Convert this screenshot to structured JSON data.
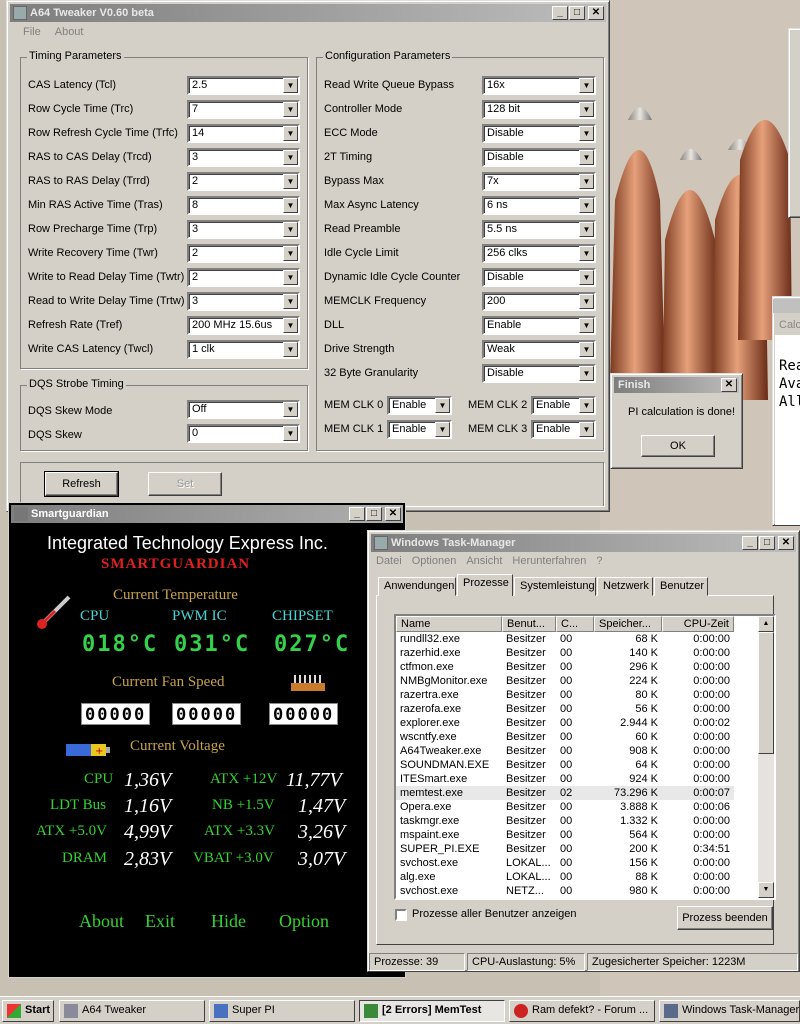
{
  "a64": {
    "title": "A64 Tweaker V0.60 beta",
    "menu": [
      "File",
      "About"
    ],
    "timing_title": "Timing Parameters",
    "timing": [
      {
        "label": "CAS Latency (Tcl)",
        "value": "2.5"
      },
      {
        "label": "Row Cycle Time (Trc)",
        "value": "7"
      },
      {
        "label": "Row Refresh Cycle Time (Trfc)",
        "value": "14"
      },
      {
        "label": "RAS to CAS Delay (Trcd)",
        "value": "3"
      },
      {
        "label": "RAS to RAS Delay (Trrd)",
        "value": "2"
      },
      {
        "label": "Min RAS Active Time (Tras)",
        "value": "8"
      },
      {
        "label": "Row Precharge Time (Trp)",
        "value": "3"
      },
      {
        "label": "Write Recovery Time (Twr)",
        "value": "2"
      },
      {
        "label": "Write to Read Delay Time (Twtr)",
        "value": "2"
      },
      {
        "label": "Read to Write Delay Time (Trtw)",
        "value": "3"
      },
      {
        "label": "Refresh Rate (Tref)",
        "value": "200 MHz 15.6us"
      },
      {
        "label": "Write CAS Latency (Twcl)",
        "value": "1 clk"
      }
    ],
    "dqs_title": "DQS Strobe Timing",
    "dqs": [
      {
        "label": "DQS Skew Mode",
        "value": "Off"
      },
      {
        "label": "DQS Skew",
        "value": "0"
      }
    ],
    "config_title": "Configuration Parameters",
    "config": [
      {
        "label": "Read Write Queue Bypass",
        "value": "16x"
      },
      {
        "label": "Controller Mode",
        "value": "128 bit"
      },
      {
        "label": "ECC Mode",
        "value": "Disable"
      },
      {
        "label": "2T Timing",
        "value": "Disable"
      },
      {
        "label": "Bypass Max",
        "value": "7x"
      },
      {
        "label": "Max Async Latency",
        "value": "6 ns"
      },
      {
        "label": "Read Preamble",
        "value": "5.5 ns"
      },
      {
        "label": "Idle Cycle Limit",
        "value": "256 clks"
      },
      {
        "label": "Dynamic Idle Cycle Counter",
        "value": "Disable"
      },
      {
        "label": "MEMCLK Frequency",
        "value": "200"
      },
      {
        "label": "DLL",
        "value": "Enable"
      },
      {
        "label": "Drive Strength",
        "value": "Weak"
      },
      {
        "label": "32 Byte Granularity",
        "value": "Disable"
      }
    ],
    "memclk": [
      {
        "label": "MEM CLK 0",
        "value": "Enable"
      },
      {
        "label": "MEM CLK 2",
        "value": "Enable"
      },
      {
        "label": "MEM CLK 1",
        "value": "Enable"
      },
      {
        "label": "MEM CLK 3",
        "value": "Enable"
      }
    ],
    "refresh": "Refresh",
    "set": "Set"
  },
  "finish": {
    "title": "Finish",
    "message": "PI calculation is done!",
    "ok": "OK"
  },
  "bg": {
    "calc": "Calc",
    "lines": [
      "Rea",
      "Ava",
      "All"
    ]
  },
  "sg": {
    "title": "Smartguardian",
    "company": "Integrated Technology Express Inc.",
    "product": "SMARTGUARDIAN",
    "temp_title": "Current Temperature",
    "temps": [
      {
        "name": "CPU",
        "value": "018°C"
      },
      {
        "name": "PWM IC",
        "value": "031°C"
      },
      {
        "name": "CHIPSET",
        "value": "027°C"
      }
    ],
    "fan_title": "Current Fan Speed",
    "fans": [
      "00000",
      "00000",
      "00000"
    ],
    "volt_title": "Current Voltage",
    "volts": [
      {
        "name": "CPU",
        "value": "1,36V"
      },
      {
        "name": "ATX +12V",
        "value": "11,77V"
      },
      {
        "name": "LDT Bus",
        "value": "1,16V"
      },
      {
        "name": "NB +1.5V",
        "value": "1,47V"
      },
      {
        "name": "ATX +5.0V",
        "value": "4,99V"
      },
      {
        "name": "ATX +3.3V",
        "value": "3,26V"
      },
      {
        "name": "DRAM",
        "value": "2,83V"
      },
      {
        "name": "VBAT +3.0V",
        "value": "3,07V"
      }
    ],
    "menu": [
      "About",
      "Exit",
      "Hide",
      "Option"
    ]
  },
  "tm": {
    "title": "Windows Task-Manager",
    "menu": [
      "Datei",
      "Optionen",
      "Ansicht",
      "Herunterfahren",
      "?"
    ],
    "tabs": [
      "Anwendungen",
      "Prozesse",
      "Systemleistung",
      "Netzwerk",
      "Benutzer"
    ],
    "columns": [
      "Name",
      "Benut...",
      "C...",
      "Speicher...",
      "CPU-Zeit"
    ],
    "rows": [
      [
        "rundll32.exe",
        "Besitzer",
        "00",
        "68 K",
        "0:00:00"
      ],
      [
        "razerhid.exe",
        "Besitzer",
        "00",
        "140 K",
        "0:00:00"
      ],
      [
        "ctfmon.exe",
        "Besitzer",
        "00",
        "296 K",
        "0:00:00"
      ],
      [
        "NMBgMonitor.exe",
        "Besitzer",
        "00",
        "224 K",
        "0:00:00"
      ],
      [
        "razertra.exe",
        "Besitzer",
        "00",
        "80 K",
        "0:00:00"
      ],
      [
        "razerofa.exe",
        "Besitzer",
        "00",
        "56 K",
        "0:00:00"
      ],
      [
        "explorer.exe",
        "Besitzer",
        "00",
        "2.944 K",
        "0:00:02"
      ],
      [
        "wscntfy.exe",
        "Besitzer",
        "00",
        "60 K",
        "0:00:00"
      ],
      [
        "A64Tweaker.exe",
        "Besitzer",
        "00",
        "908 K",
        "0:00:00"
      ],
      [
        "SOUNDMAN.EXE",
        "Besitzer",
        "00",
        "64 K",
        "0:00:00"
      ],
      [
        "ITESmart.exe",
        "Besitzer",
        "00",
        "924 K",
        "0:00:00"
      ],
      [
        "memtest.exe",
        "Besitzer",
        "02",
        "73.296 K",
        "0:00:07"
      ],
      [
        "Opera.exe",
        "Besitzer",
        "00",
        "3.888 K",
        "0:00:06"
      ],
      [
        "taskmgr.exe",
        "Besitzer",
        "00",
        "1.332 K",
        "0:00:00"
      ],
      [
        "mspaint.exe",
        "Besitzer",
        "00",
        "564 K",
        "0:00:00"
      ],
      [
        "SUPER_PI.EXE",
        "Besitzer",
        "00",
        "200 K",
        "0:34:51"
      ],
      [
        "svchost.exe",
        "LOKAL...",
        "00",
        "156 K",
        "0:00:00"
      ],
      [
        "alg.exe",
        "LOKAL...",
        "00",
        "88 K",
        "0:00:00"
      ],
      [
        "svchost.exe",
        "NETZ...",
        "00",
        "980 K",
        "0:00:00"
      ]
    ],
    "show_all": "Prozesse aller Benutzer anzeigen",
    "end_process": "Prozess beenden",
    "status": [
      "Prozesse: 39",
      "CPU-Auslastung: 5%",
      "Zugesicherter Speicher: 1223M"
    ]
  },
  "taskbar": {
    "start": "Start",
    "items": [
      "A64 Tweaker",
      "Super PI",
      "[2 Errors] MemTest",
      "Ram defekt? - Forum ...",
      "Windows Task-Manager"
    ]
  }
}
